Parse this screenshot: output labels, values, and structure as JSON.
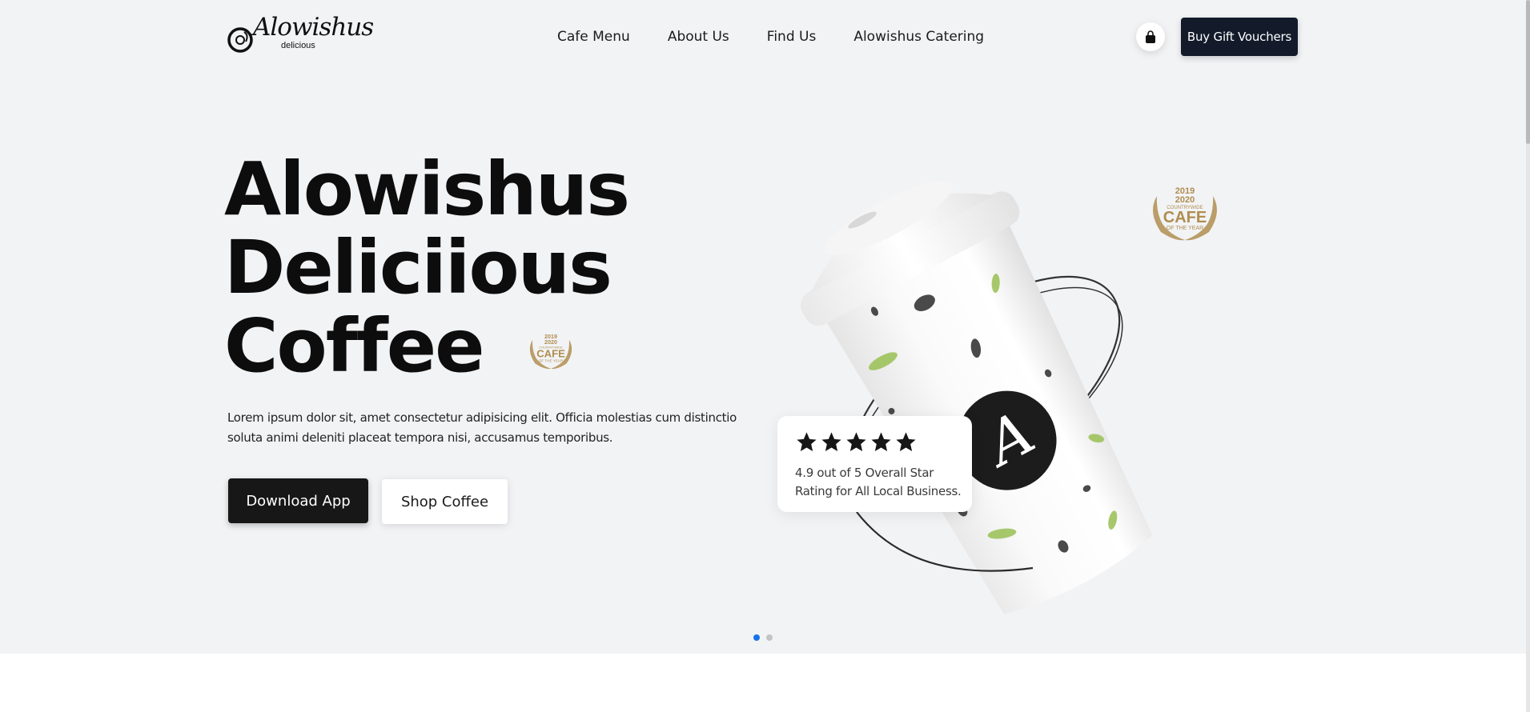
{
  "brand": {
    "logo_script": "Alowishus",
    "logo_sub": "delicious"
  },
  "nav": {
    "items": [
      {
        "label": "Cafe Menu"
      },
      {
        "label": "About Us"
      },
      {
        "label": "Find Us"
      },
      {
        "label": "Alowishus Catering"
      }
    ]
  },
  "header": {
    "cart_icon": "shopping-bag-icon",
    "gift_button": "Buy Gift Vouchers"
  },
  "hero": {
    "title_lines": [
      "Alowishus",
      "Deliciious",
      "Coffee"
    ],
    "description": "Lorem ipsum dolor sit, amet consectetur adipisicing elit. Officia molestias cum distinctio soluta animi deleniti placeat tempora nisi, accusamus temporibus.",
    "primary_button": "Download App",
    "secondary_button": "Shop Coffee"
  },
  "award": {
    "year_1": "2019",
    "year_2": "2020",
    "top": "COUNTRYWIDE",
    "main": "CAFE",
    "bottom": "OF THE YEAR"
  },
  "cup": {
    "monogram": "A"
  },
  "rating": {
    "stars": 5,
    "text_line1": "4.9 out of 5 Overall Star",
    "text_line2": "Rating for All Local Business."
  },
  "carousel": {
    "total": 2,
    "active_index": 0
  },
  "colors": {
    "hero_bg": "#f2f3f5",
    "dark_button": "#171717",
    "navy_button": "#131b2b",
    "gold": "#b08d4f",
    "dot_active": "#1a73e8",
    "dot_inactive": "#c4c4c4",
    "leaf_green": "#9cc25a"
  }
}
